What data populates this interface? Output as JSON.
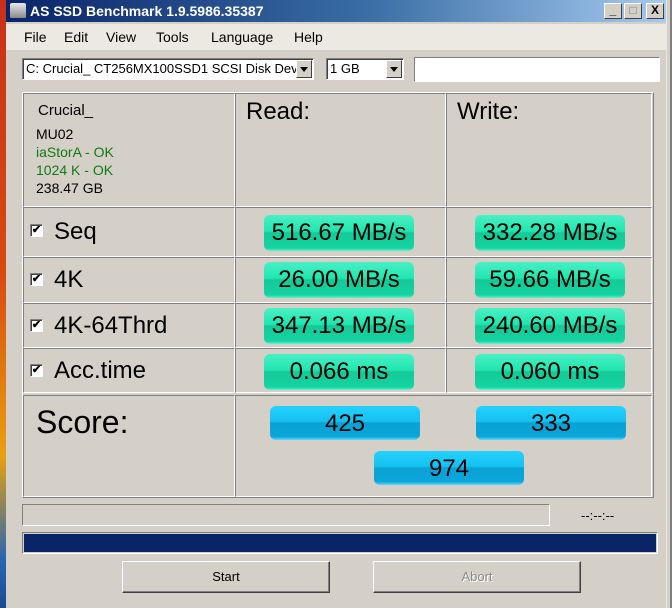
{
  "window": {
    "title": "AS SSD Benchmark 1.9.5986.35387",
    "controls": {
      "minimize": "_",
      "maximize": "□",
      "close": "X"
    }
  },
  "menu": [
    "File",
    "Edit",
    "View",
    "Tools",
    "Language",
    "Help"
  ],
  "toolbar": {
    "drive_select": "C: Crucial_ CT256MX100SSD1 SCSI Disk Dev",
    "size_select": "1 GB",
    "text_field": ""
  },
  "drive_info": {
    "name": "Crucial_",
    "firmware": "MU02",
    "driver_status": "iaStorA - OK",
    "alignment_status": "1024 K - OK",
    "capacity": "238.47 GB"
  },
  "headers": {
    "read": "Read:",
    "write": "Write:"
  },
  "tests": [
    {
      "label": "Seq",
      "checked": true,
      "read": "516.67 MB/s",
      "write": "332.28 MB/s"
    },
    {
      "label": "4K",
      "checked": true,
      "read": "26.00 MB/s",
      "write": "59.66 MB/s"
    },
    {
      "label": "4K-64Thrd",
      "checked": true,
      "read": "347.13 MB/s",
      "write": "240.60 MB/s"
    },
    {
      "label": "Acc.time",
      "checked": true,
      "read": "0.066 ms",
      "write": "0.060 ms"
    }
  ],
  "score": {
    "label": "Score:",
    "read": "425",
    "write": "333",
    "total": "974"
  },
  "status": {
    "text": "",
    "time": "--:--:--",
    "progress_percent": 100
  },
  "buttons": {
    "start": "Start",
    "abort": "Abort"
  },
  "icons": {
    "app": "disk-icon",
    "check": "✔"
  },
  "colors": {
    "result_pill": "#20e6b0",
    "score_pill": "#14c2f2",
    "progress": "#0a2468",
    "status_ok": "#127a12"
  }
}
